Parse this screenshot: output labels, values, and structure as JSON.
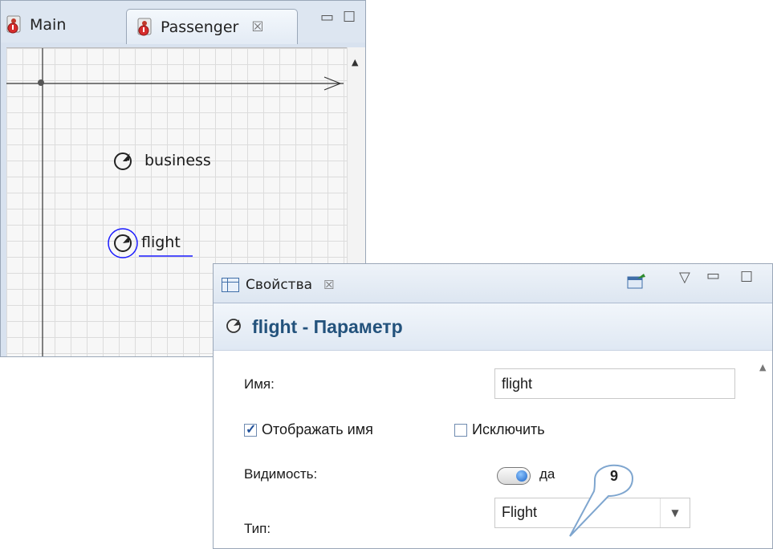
{
  "editor": {
    "tabs": [
      {
        "label": "Main"
      },
      {
        "label": "Passenger"
      }
    ],
    "close_glyph": "☒",
    "canvas": {
      "parameters": [
        {
          "label": "business",
          "icon": "parameter-icon"
        },
        {
          "label": "flight",
          "icon": "parameter-icon",
          "selected": true
        }
      ]
    }
  },
  "properties": {
    "tab_label": "Свойства",
    "header_title": "flight - Параметр",
    "fields": {
      "name_label": "Имя:",
      "name_value": "flight",
      "show_name_label": "Отображать имя",
      "show_name_checked": true,
      "exclude_label": "Исключить",
      "exclude_checked": false,
      "visibility_label": "Видимость:",
      "visibility_value": "да",
      "type_label": "Тип:",
      "type_value": "Flight"
    }
  },
  "callout": {
    "number": "9"
  },
  "colors": {
    "accent": "#23527c",
    "selection": "#1a1aff",
    "toggle_knob": "#1b63c6"
  }
}
